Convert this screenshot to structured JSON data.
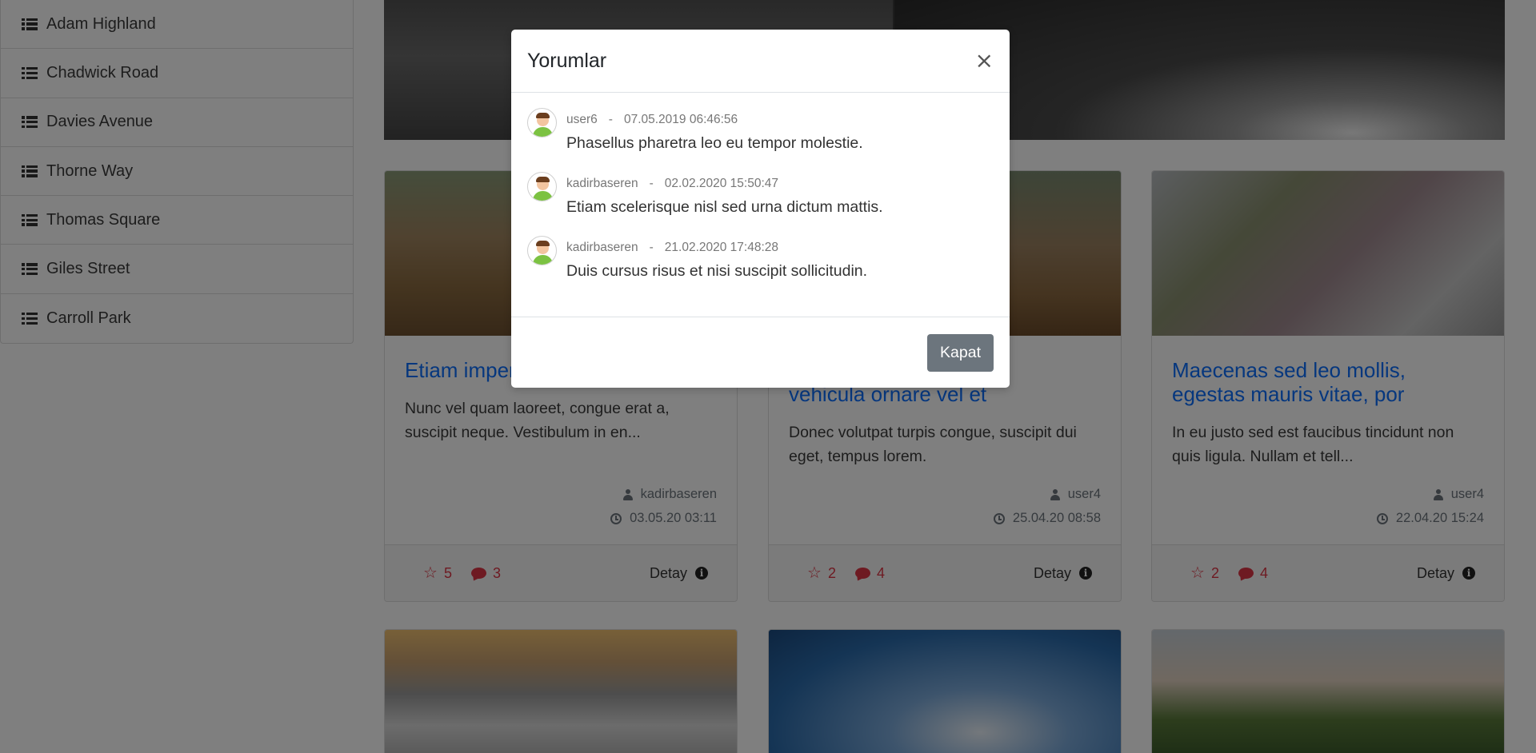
{
  "sidebar": {
    "items": [
      {
        "label": "Adam Highland"
      },
      {
        "label": "Chadwick Road"
      },
      {
        "label": "Davies Avenue"
      },
      {
        "label": "Thorne Way"
      },
      {
        "label": "Thomas Square"
      },
      {
        "label": "Giles Street"
      },
      {
        "label": "Carroll Park"
      }
    ]
  },
  "cards": [
    {
      "title": "Etiam imperdiet fringilla, vitae",
      "excerpt": "Nunc vel quam laoreet, congue erat a, suscipit neque. Vestibulum in en...",
      "author": "kadirbaseren",
      "date": "03.05.20 03:11",
      "stars": "5",
      "comments": "3",
      "detail_label": "Detay"
    },
    {
      "title": "vehicula ornare vel et",
      "excerpt": "Donec volutpat turpis congue, suscipit dui eget, tempus lorem.",
      "author": "user4",
      "date": "25.04.20 08:58",
      "stars": "2",
      "comments": "4",
      "detail_label": "Detay"
    },
    {
      "title": "Maecenas sed leo mollis, egestas mauris vitae, por",
      "excerpt": "In eu justo sed est faucibus tincidunt non quis ligula. Nullam et tell...",
      "author": "user4",
      "date": "22.04.20 15:24",
      "stars": "2",
      "comments": "4",
      "detail_label": "Detay"
    }
  ],
  "modal": {
    "title": "Yorumlar",
    "close_glyph": "×",
    "close_button_label": "Kapat",
    "comments": [
      {
        "user": "user6",
        "separator": "-",
        "datetime": "07.05.2019 06:46:56",
        "text": "Phasellus pharetra leo eu tempor molestie."
      },
      {
        "user": "kadirbaseren",
        "separator": "-",
        "datetime": "02.02.2020 15:50:47",
        "text": "Etiam scelerisque nisl sed urna dictum mattis."
      },
      {
        "user": "kadirbaseren",
        "separator": "-",
        "datetime": "21.02.2020 17:48:28",
        "text": "Duis cursus risus et nisi suscipit sollicitudin."
      }
    ]
  },
  "colors": {
    "link_title": "#0d6efd",
    "stat_red": "#dc3545",
    "button_gray": "#6c757d"
  }
}
